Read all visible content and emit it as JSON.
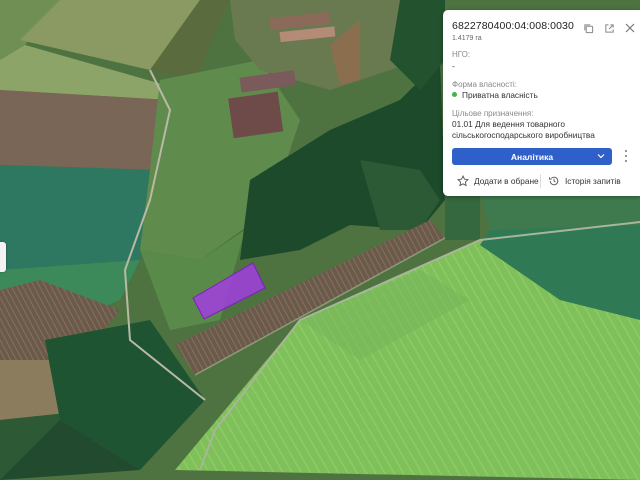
{
  "parcel": {
    "cadastral_number": "6822780400:04:008:0030",
    "area": "1.4179 га"
  },
  "fields": {
    "ngo_label": "НГО:",
    "ngo_value": "-",
    "ownership_label": "Форма власності:",
    "ownership_value": "Приватна власність",
    "ownership_color": "#3cb54a",
    "purpose_label": "Цільове призначення:",
    "purpose_line1": "01.01 Для ведення товарного",
    "purpose_line2": "сільськогосподарського виробництва"
  },
  "actions": {
    "analytics_label": "Аналітика",
    "favorite_label": "Додати в обране",
    "history_label": "Історія запитів"
  },
  "icons": {
    "copy": "copy-icon",
    "open": "external-link-icon",
    "close": "close-icon",
    "star": "star-icon",
    "history": "history-icon"
  },
  "colors": {
    "parcel_fill": "#a23de0",
    "accent": "#2f5fc9"
  }
}
